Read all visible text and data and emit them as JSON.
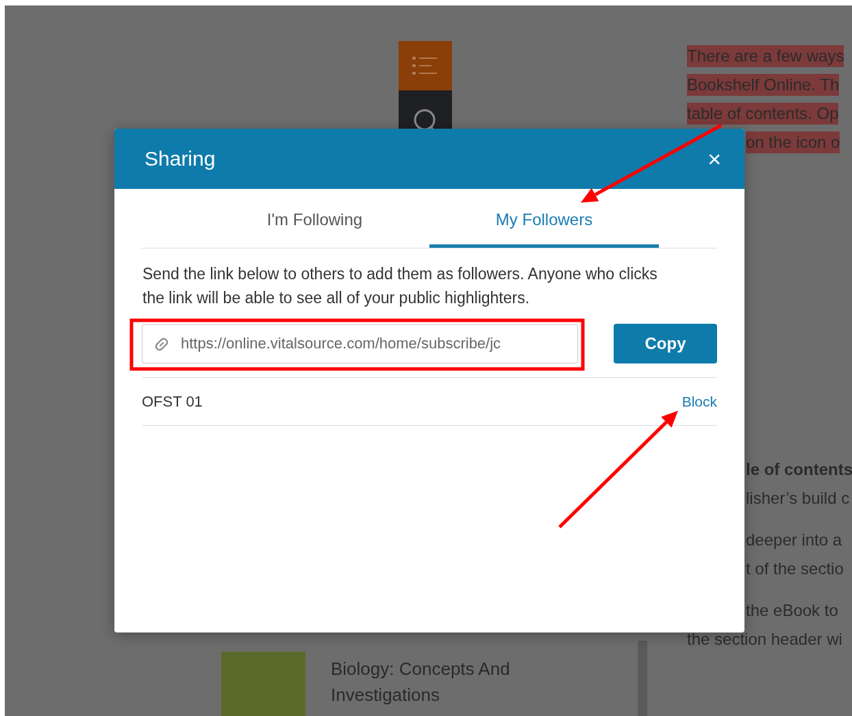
{
  "background": {
    "article_lines": [
      {
        "kind": "highlighted",
        "covered": false,
        "text": "There are a few ways"
      },
      {
        "kind": "highlighted",
        "covered": false,
        "text": "Bookshelf Online.  Th"
      },
      {
        "kind": "highlighted",
        "covered": false,
        "text": "table of contents. Op"
      },
      {
        "kind": "highlighted",
        "covered": true,
        "text": "on the icon o"
      },
      {
        "kind": "bold",
        "covered": true,
        "text": "le of contents"
      },
      {
        "kind": "plain",
        "covered": true,
        "text": "lisher’s build c"
      },
      {
        "kind": "plain",
        "covered": true,
        "text": "deeper into a"
      },
      {
        "kind": "plain",
        "covered": true,
        "text": "t of the sectio"
      },
      {
        "kind": "plain",
        "covered": true,
        "text": "the eBook to"
      },
      {
        "kind": "plain",
        "covered": false,
        "text": "the section header wi"
      }
    ],
    "book": {
      "title": "Biology: Concepts And Investigations"
    }
  },
  "dialog": {
    "title": "Sharing",
    "close": "×",
    "tabs": [
      {
        "label": "I'm Following",
        "selected": false
      },
      {
        "label": "My Followers",
        "selected": true
      }
    ],
    "description": "Send the link below to others to add them as followers. Anyone who clicks the link will be able to see all of your public highlighters.",
    "link": {
      "value": "https://online.vitalsource.com/home/subscribe/jc"
    },
    "copy_button": "Copy",
    "followers": [
      {
        "name": "OFST 01",
        "action": "Block"
      }
    ]
  },
  "annotations": [
    {
      "kind": "frame"
    },
    {
      "kind": "arrow"
    },
    {
      "kind": "arrow"
    }
  ]
}
